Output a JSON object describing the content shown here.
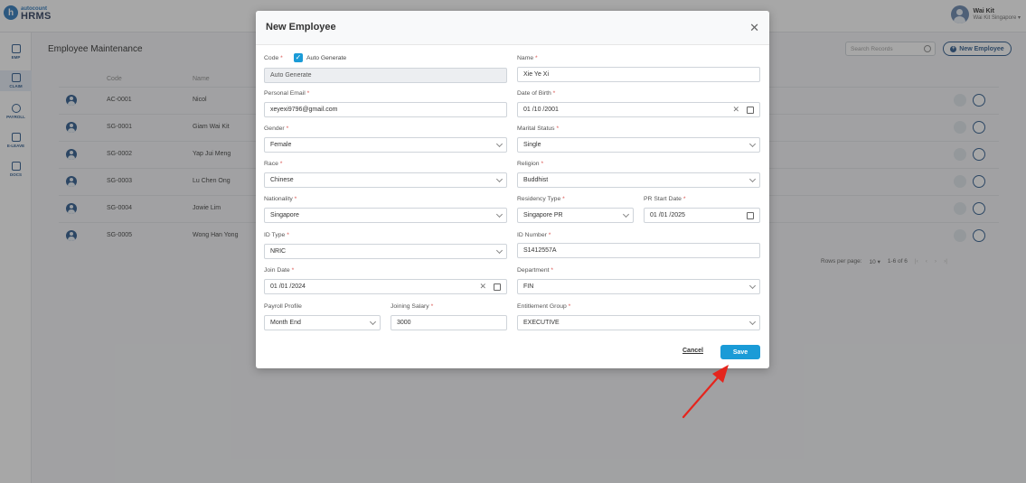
{
  "app": {
    "logo_small": "autocount",
    "logo_big": "HRMS",
    "user_name": "Wai Kit",
    "user_company": "Wai Kit Singapore"
  },
  "sidebar": {
    "items": [
      {
        "label": "EMP"
      },
      {
        "label": "CLAIM"
      },
      {
        "label": "PAYROLL"
      },
      {
        "label": "E-LEAVE"
      },
      {
        "label": "DOCS"
      }
    ]
  },
  "main": {
    "title": "Employee Maintenance",
    "search_placeholder": "Search Records",
    "new_button": "New Employee",
    "columns": {
      "code": "Code",
      "name": "Name"
    },
    "rows": [
      {
        "code": "AC-0001",
        "name": "Nicol"
      },
      {
        "code": "SG-0001",
        "name": "Giam Wai Kit"
      },
      {
        "code": "SG-0002",
        "name": "Yap Jui Meng"
      },
      {
        "code": "SG-0003",
        "name": "Lu Chen Ong"
      },
      {
        "code": "SG-0004",
        "name": "Jowie Lim"
      },
      {
        "code": "SG-0005",
        "name": "Wong Han Yong"
      }
    ],
    "pagination": {
      "rows_label": "Rows per page:",
      "rows_value": "10",
      "range": "1-6 of 6"
    }
  },
  "modal": {
    "title": "New Employee",
    "auto_generate": "Auto Generate",
    "fields": {
      "code": {
        "label": "Code",
        "value": "Auto Generate"
      },
      "name": {
        "label": "Name",
        "value": "Xie Ye Xi"
      },
      "email": {
        "label": "Personal Email",
        "value": "xeyexi9796@gmail.com"
      },
      "dob": {
        "label": "Date of Birth",
        "value": "01 /10 /2001"
      },
      "gender": {
        "label": "Gender",
        "value": "Female"
      },
      "marital": {
        "label": "Marital Status",
        "value": "Single"
      },
      "race": {
        "label": "Race",
        "value": "Chinese"
      },
      "religion": {
        "label": "Religion",
        "value": "Buddhist"
      },
      "nationality": {
        "label": "Nationality",
        "value": "Singapore"
      },
      "residency": {
        "label": "Residency Type",
        "value": "Singapore PR"
      },
      "pr_start": {
        "label": "PR Start Date",
        "value": "01 /01 /2025"
      },
      "id_type": {
        "label": "ID Type",
        "value": "NRIC"
      },
      "id_number": {
        "label": "ID Number",
        "value": "S1412557A"
      },
      "join_date": {
        "label": "Join Date",
        "value": "01 /01 /2024"
      },
      "department": {
        "label": "Department",
        "value": "FIN"
      },
      "payroll_profile": {
        "label": "Payroll Profile",
        "value": "Month End"
      },
      "joining_salary": {
        "label": "Joining Salary",
        "value": "3000"
      },
      "entitlement": {
        "label": "Entitlement Group",
        "value": "EXECUTIVE"
      }
    },
    "cancel": "Cancel",
    "save": "Save"
  },
  "colors": {
    "accent": "#1a9bd7",
    "brand": "#1f4f85",
    "required": "#d9534f",
    "arrow": "#e5251d"
  }
}
